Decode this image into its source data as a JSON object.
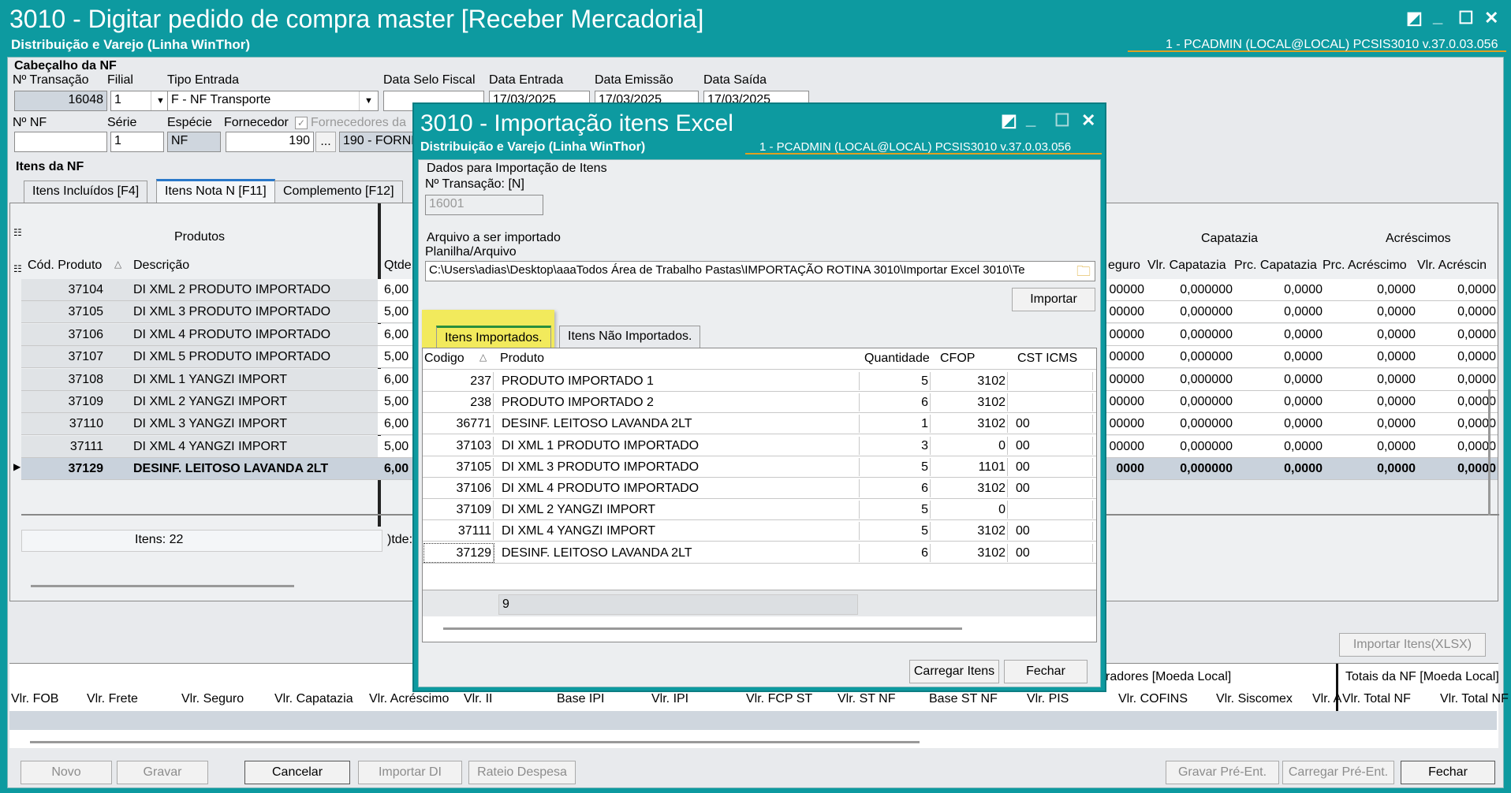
{
  "main": {
    "title": "3010 - Digitar pedido de compra master [Receber Mercadoria]",
    "subtitle": "Distribuição e Varejo (Linha WinThor)",
    "sysinfo": "1 - PCADMIN (LOCAL@LOCAL)   PCSIS3010  v.37.0.03.056",
    "header_section": "Cabeçalho da NF",
    "labels": {
      "transacao": "Nº Transação",
      "filial": "Filial",
      "tipo_entrada": "Tipo Entrada",
      "data_selo": "Data Selo Fiscal",
      "data_entrada": "Data Entrada",
      "data_emissao": "Data Emissão",
      "data_saida": "Data Saída",
      "nf": "Nº NF",
      "serie": "Série",
      "especie": "Espécie",
      "fornecedor": "Fornecedor",
      "fornecedores_da": "Fornecedores da"
    },
    "values": {
      "transacao": "16048",
      "filial": "1",
      "tipo_entrada": "F - NF Transporte",
      "data_entrada": "17/03/2025",
      "data_emissao": "17/03/2025",
      "data_saida": "17/03/2025",
      "serie": "1",
      "especie": "NF",
      "fornecedor": "190",
      "fornecedor_nome": "190 - FORNE",
      "ellipsis": "..."
    },
    "items_section": "Itens da NF",
    "tabs": [
      "Itens Incluídos [F4]",
      "Itens Nota N [F11]",
      "Complemento [F12]"
    ],
    "grid": {
      "group_produtos": "Produtos",
      "group_capatazia": "Capatazia",
      "group_acrescimos": "Acréscimos",
      "cols_left": [
        "Cód. Produto",
        "Descrição",
        "Qtde"
      ],
      "cols_right": [
        "eguro",
        "Vlr. Capatazia",
        "Prc. Capatazia",
        "Prc. Acréscimo",
        "Vlr. Acréscin"
      ],
      "rows": [
        {
          "cod": "37104",
          "desc": "DI XML 2 PRODUTO IMPORTADO",
          "qt": "6,00",
          "seg": "00000",
          "vcap": "0,000000",
          "pcap": "0,0000",
          "pacr": "0,0000",
          "vacr": "0,0000"
        },
        {
          "cod": "37105",
          "desc": "DI XML 3 PRODUTO IMPORTADO",
          "qt": "5,00",
          "seg": "00000",
          "vcap": "0,000000",
          "pcap": "0,0000",
          "pacr": "0,0000",
          "vacr": "0,0000"
        },
        {
          "cod": "37106",
          "desc": "DI XML 4 PRODUTO IMPORTADO",
          "qt": "6,00",
          "seg": "00000",
          "vcap": "0,000000",
          "pcap": "0,0000",
          "pacr": "0,0000",
          "vacr": "0,0000"
        },
        {
          "cod": "37107",
          "desc": "DI XML 5 PRODUTO IMPORTADO",
          "qt": "5,00",
          "seg": "00000",
          "vcap": "0,000000",
          "pcap": "0,0000",
          "pacr": "0,0000",
          "vacr": "0,0000"
        },
        {
          "cod": "37108",
          "desc": "DI XML 1 YANGZI IMPORT",
          "qt": "6,00",
          "seg": "00000",
          "vcap": "0,000000",
          "pcap": "0,0000",
          "pacr": "0,0000",
          "vacr": "0,0000"
        },
        {
          "cod": "37109",
          "desc": "DI XML 2 YANGZI IMPORT",
          "qt": "5,00",
          "seg": "00000",
          "vcap": "0,000000",
          "pcap": "0,0000",
          "pacr": "0,0000",
          "vacr": "0,0000"
        },
        {
          "cod": "37110",
          "desc": "DI XML 3 YANGZI IMPORT",
          "qt": "6,00",
          "seg": "00000",
          "vcap": "0,000000",
          "pcap": "0,0000",
          "pacr": "0,0000",
          "vacr": "0,0000"
        },
        {
          "cod": "37111",
          "desc": "DI XML 4 YANGZI IMPORT",
          "qt": "5,00",
          "seg": "00000",
          "vcap": "0,000000",
          "pcap": "0,0000",
          "pacr": "0,0000",
          "vacr": "0,0000"
        },
        {
          "cod": "37129",
          "desc": "DESINF. LEITOSO LAVANDA 2LT",
          "qt": "6,00",
          "seg": "0000",
          "vcap": "0,000000",
          "pcap": "0,0000",
          "pacr": "0,0000",
          "vacr": "0,0000"
        }
      ],
      "footer_itens": "Itens: 22",
      "footer_qtde": ")tde:"
    },
    "importar_xlsx": "Importar Itens(XLSX)",
    "totals": {
      "group_left": "radores [Moeda Local]",
      "group_right": "Totais da NF [Moeda Local]",
      "cols": [
        "Vlr. FOB",
        "Vlr. Frete",
        "Vlr. Seguro",
        "Vlr. Capatazia",
        "Vlr. Acréscimo",
        "Vlr. II",
        "Base IPI",
        "Vlr. IPI",
        "Vlr. FCP ST",
        "Vlr. ST NF",
        "Base ST NF",
        "Vlr. PIS",
        "Vlr. COFINS",
        "Vlr. Siscomex",
        "Vlr. A",
        "Vlr. Total NF",
        "Vlr. Total NF"
      ]
    },
    "buttons": {
      "novo": "Novo",
      "gravar": "Gravar",
      "cancelar": "Cancelar",
      "importar_di": "Importar DI",
      "rateio": "Rateio Despesa",
      "gravar_pre": "Gravar Pré-Ent.",
      "carregar_pre": "Carregar Pré-Ent.",
      "fechar": "Fechar"
    }
  },
  "dialog": {
    "title": "3010 - Importação itens Excel",
    "subtitle": "Distribuição e Varejo (Linha WinThor)",
    "sysinfo": "1 - PCADMIN (LOCAL@LOCAL)   PCSIS3010  v.37.0.03.056",
    "group_dados": "Dados para Importação de Itens",
    "transacao_label": "Nº Transação: [N]",
    "transacao_value": "16001",
    "arquivo_label": "Arquivo a ser importado",
    "planilha_label": "Planilha/Arquivo",
    "path": "C:\\Users\\adias\\Desktop\\aaaTodos Área de Trabalho Pastas\\IMPORTAÇÃO ROTINA 3010\\Importar Excel 3010\\Te",
    "importar_btn": "Importar",
    "tabs": [
      "Itens Importados.",
      "Itens Não Importados."
    ],
    "columns": [
      "Codigo",
      "Produto",
      "Quantidade",
      "CFOP",
      "CST ICMS"
    ],
    "rows": [
      {
        "codigo": "237",
        "produto": "PRODUTO IMPORTADO 1",
        "qtd": "5",
        "cfop": "3102",
        "cst": ""
      },
      {
        "codigo": "238",
        "produto": "PRODUTO IMPORTADO 2",
        "qtd": "6",
        "cfop": "3102",
        "cst": ""
      },
      {
        "codigo": "36771",
        "produto": "DESINF. LEITOSO LAVANDA 2LT",
        "qtd": "1",
        "cfop": "3102",
        "cst": "00"
      },
      {
        "codigo": "37103",
        "produto": "DI XML 1 PRODUTO IMPORTADO",
        "qtd": "3",
        "cfop": "0",
        "cst": "00"
      },
      {
        "codigo": "37105",
        "produto": "DI XML 3 PRODUTO IMPORTADO",
        "qtd": "5",
        "cfop": "1101",
        "cst": "00"
      },
      {
        "codigo": "37106",
        "produto": "DI XML 4 PRODUTO IMPORTADO",
        "qtd": "6",
        "cfop": "3102",
        "cst": "00"
      },
      {
        "codigo": "37109",
        "produto": "DI XML 2 YANGZI IMPORT",
        "qtd": "5",
        "cfop": "0",
        "cst": ""
      },
      {
        "codigo": "37111",
        "produto": "DI XML 4 YANGZI IMPORT",
        "qtd": "5",
        "cfop": "3102",
        "cst": "00"
      },
      {
        "codigo": "37129",
        "produto": "DESINF. LEITOSO LAVANDA 2LT",
        "qtd": "6",
        "cfop": "3102",
        "cst": "00"
      }
    ],
    "footer_count": "9",
    "carregar_btn": "Carregar Itens",
    "fechar_btn": "Fechar"
  },
  "colors": {
    "titlebar": "#0d9aa0",
    "highlight_tab": "#f2ea5c",
    "accent_line": "#e0a020"
  }
}
